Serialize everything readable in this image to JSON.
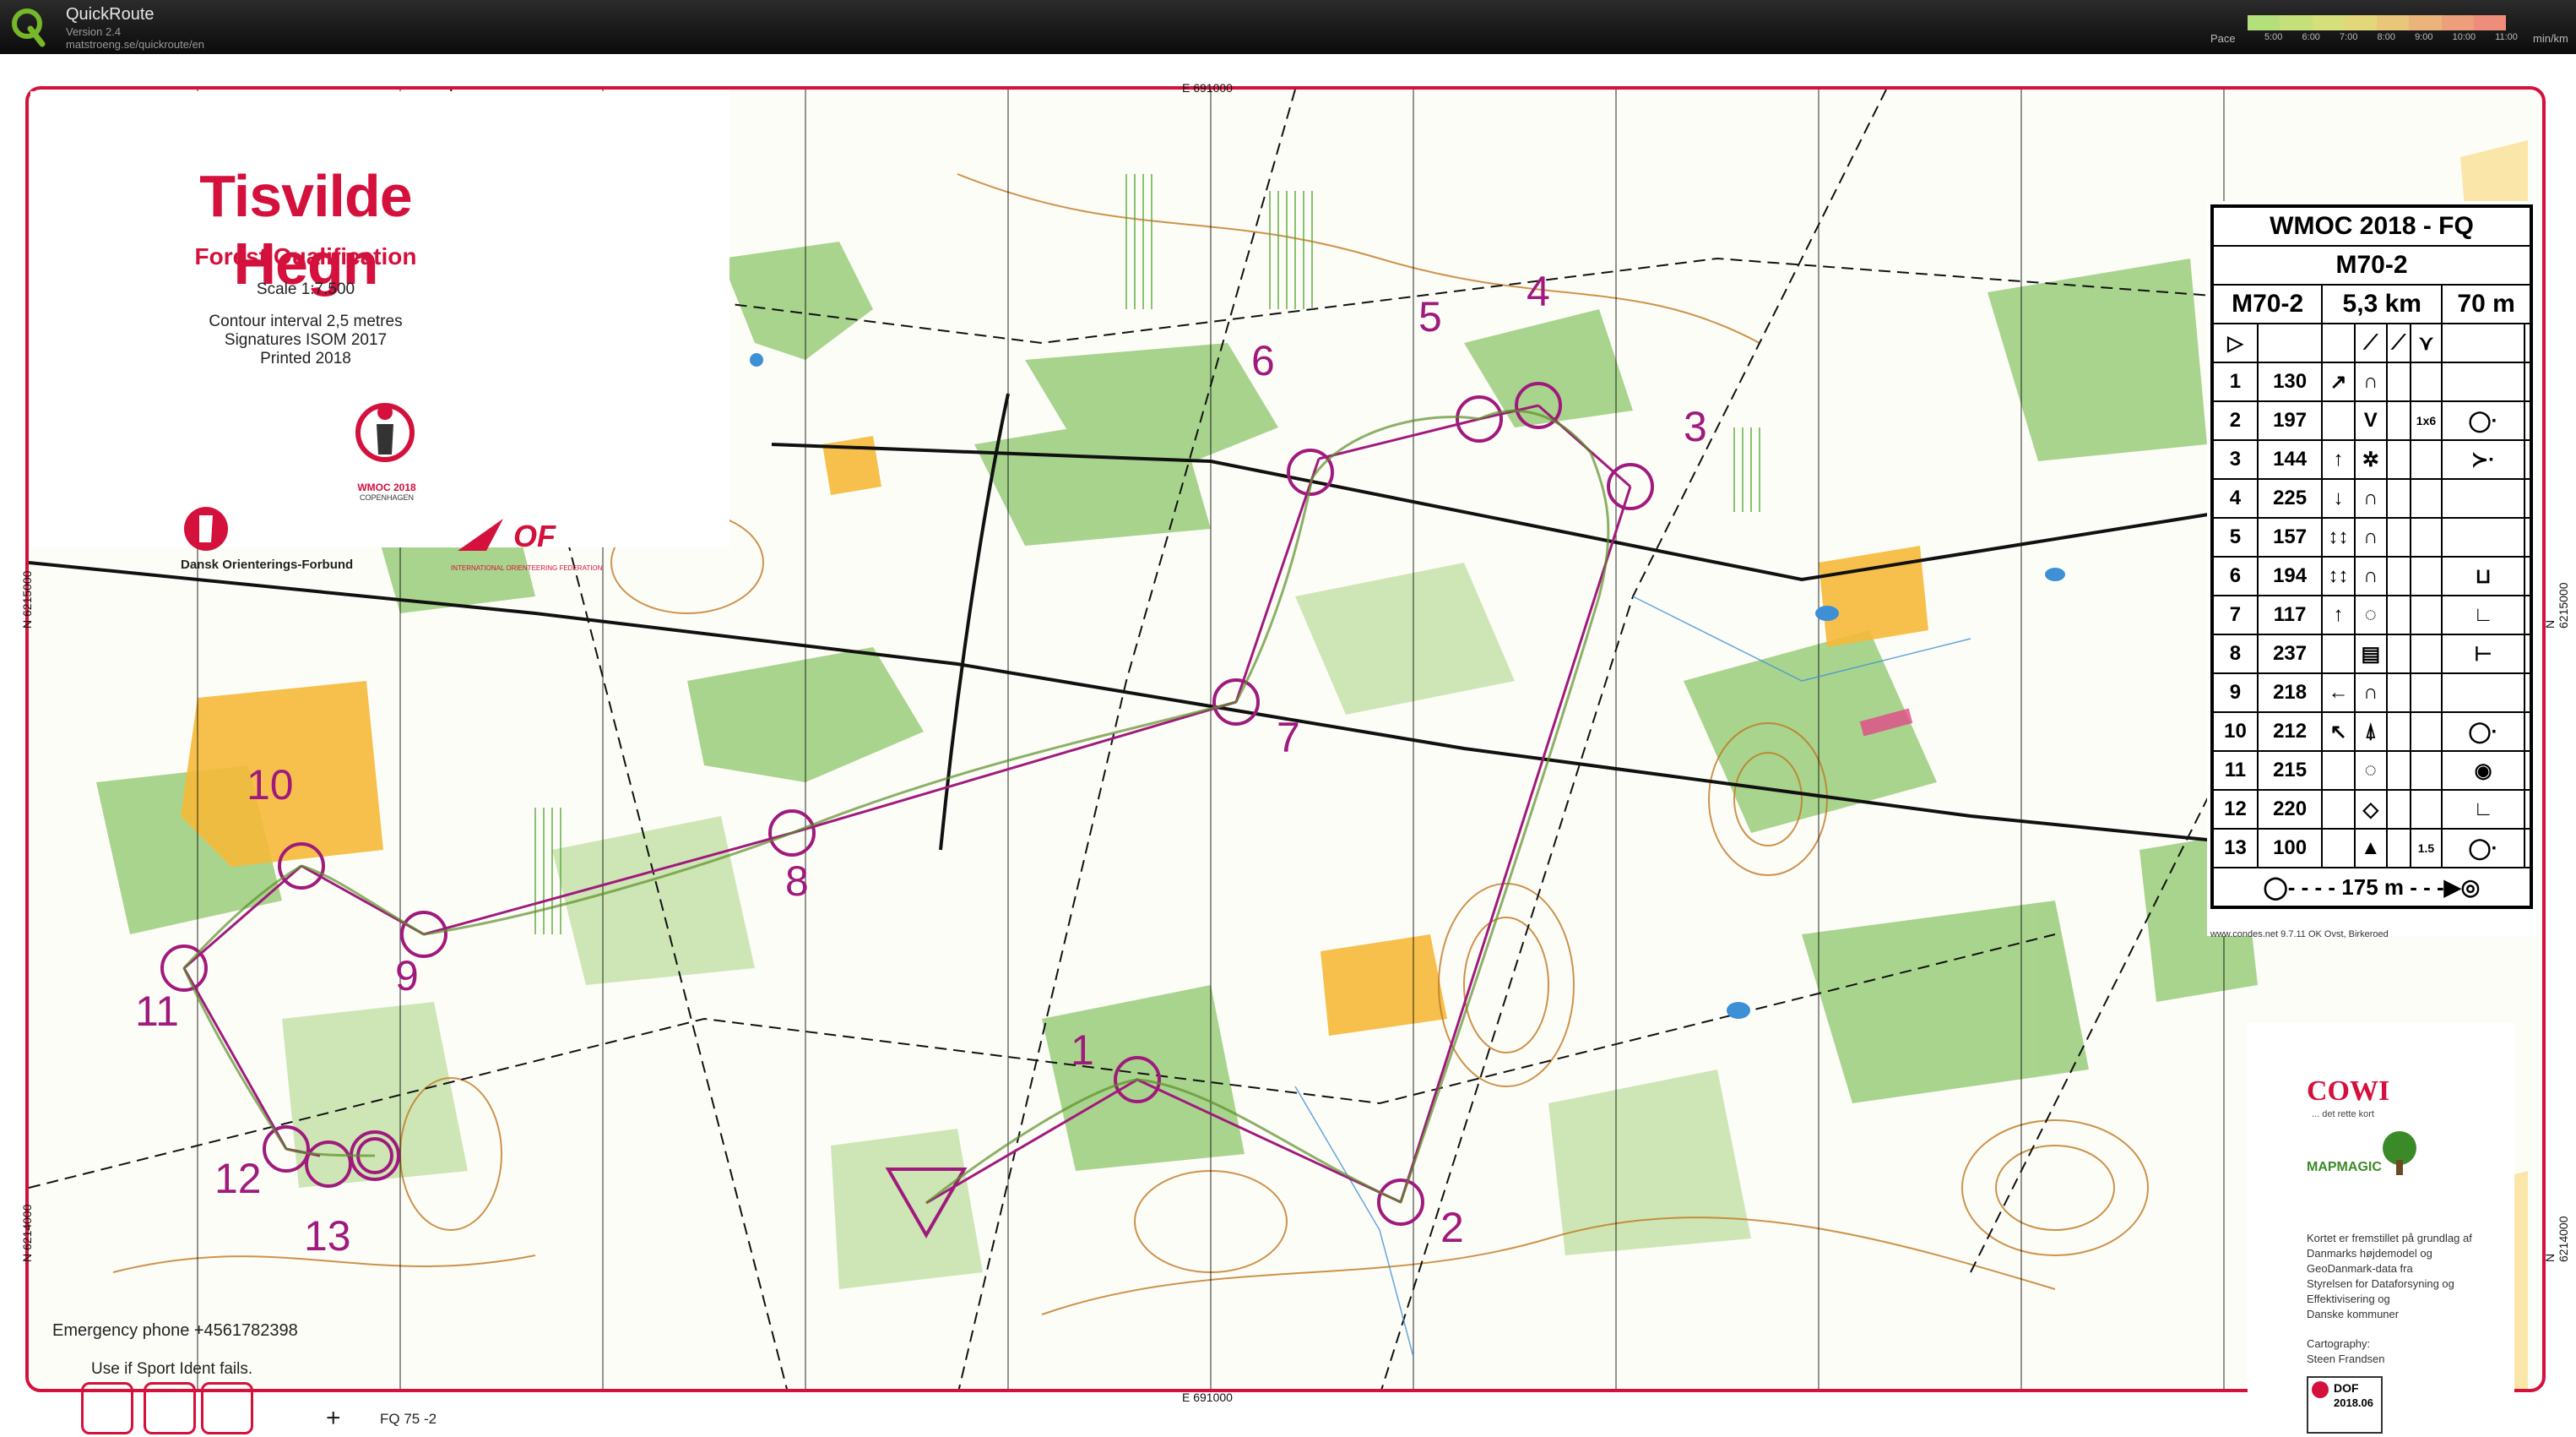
{
  "app": {
    "name": "QuickRoute",
    "version": "Version 2.4",
    "url": "matstroeng.se/quickroute/en"
  },
  "pace_scale": {
    "label": "Pace",
    "ticks": [
      "5:00",
      "6:00",
      "7:00",
      "8:00",
      "9:00",
      "10:00",
      "11:00"
    ],
    "unit": "min/km",
    "colors": [
      "#b3e07a",
      "#c5e07a",
      "#d6e07a",
      "#e2d87a",
      "#e8c67a",
      "#eab47a",
      "#ec9f7a",
      "#ee8d7a"
    ]
  },
  "map": {
    "title": "Tisvilde Hegn",
    "subtitle": "Forest Qualification",
    "scale": "Scale 1:7.500",
    "contour": "Contour interval 2,5 metres",
    "signatures": "Signatures ISOM 2017",
    "printed": "Printed 2018",
    "event_logo_text": "WMOC 2018",
    "event_logo_sub": "COPENHAGEN",
    "federation": "Dansk Orienterings-Forbund",
    "iof_logo": "OF",
    "iof_caption": "INTERNATIONAL ORIENTEERING FEDERATION",
    "grid_top": "E 691000",
    "grid_bottom": "E 691000",
    "grid_left_1": "N 6215000",
    "grid_left_2": "N 6214000",
    "grid_right_1": "N 6215000",
    "grid_right_2": "N 6214000",
    "emergency": "Emergency phone +4561782398",
    "si_note": "Use if Sport Ident fails.",
    "fq_label": "FQ 75 -2",
    "colors": {
      "frame": "#d4103c",
      "course": "#a01a7d",
      "forest": "#7fbf5b",
      "open": "#f6b93a",
      "contour": "#c07820"
    }
  },
  "course": {
    "control_numbers": [
      "1",
      "2",
      "3",
      "4",
      "5",
      "6",
      "7",
      "8",
      "9",
      "10",
      "11",
      "12",
      "13"
    ]
  },
  "control_description": {
    "event": "WMOC 2018 - FQ",
    "class": "M70-2",
    "course": "M70-2",
    "length": "5,3 km",
    "climb": "70 m",
    "rows": [
      {
        "n": "1",
        "code": "130",
        "dir": "↗",
        "feat": "∩",
        "extra": "",
        "where": ""
      },
      {
        "n": "2",
        "code": "197",
        "dir": "",
        "feat": "V",
        "extra": "1x6",
        "where": "◯·"
      },
      {
        "n": "3",
        "code": "144",
        "dir": "↑",
        "feat": "✲",
        "extra": "",
        "where": "≻·"
      },
      {
        "n": "4",
        "code": "225",
        "dir": "↓",
        "feat": "∩",
        "extra": "",
        "where": ""
      },
      {
        "n": "5",
        "code": "157",
        "dir": "↕↕",
        "feat": "∩",
        "extra": "",
        "where": ""
      },
      {
        "n": "6",
        "code": "194",
        "dir": "↕↕",
        "feat": "∩",
        "extra": "",
        "where": "⊔"
      },
      {
        "n": "7",
        "code": "117",
        "dir": "↑",
        "feat": "◌",
        "extra": "",
        "where": "∟"
      },
      {
        "n": "8",
        "code": "237",
        "dir": "",
        "feat": "▤",
        "extra": "",
        "where": "⊢"
      },
      {
        "n": "9",
        "code": "218",
        "dir": "←",
        "feat": "∩",
        "extra": "",
        "where": ""
      },
      {
        "n": "10",
        "code": "212",
        "dir": "↖",
        "feat": "⍋",
        "extra": "",
        "where": "◯·"
      },
      {
        "n": "11",
        "code": "215",
        "dir": "",
        "feat": "◌",
        "extra": "",
        "where": "◉"
      },
      {
        "n": "12",
        "code": "220",
        "dir": "",
        "feat": "◇",
        "extra": "",
        "where": "∟"
      },
      {
        "n": "13",
        "code": "100",
        "dir": "",
        "feat": "▲",
        "extra": "1.5",
        "where": "◯·"
      }
    ],
    "finish_distance": "175 m",
    "footer": "www.condes.net 9.7.11 OK Ovst, Birkeroed"
  },
  "sponsor": {
    "cowi": "COWI",
    "cowi_tag": "... det rette kort",
    "mapmagic": "MAPMAGIC",
    "credit_lines": [
      "Kortet er fremstillet på grundlag af",
      "Danmarks højdemodel og",
      "GeoDanmark-data  fra",
      "Styrelsen for Dataforsyning og",
      "Effektivisering og",
      "Danske kommuner"
    ],
    "cartography_label": "Cartography:",
    "cartographer": "Steen Frandsen",
    "dof_badge": "DOF",
    "dof_number": "2018.06"
  }
}
